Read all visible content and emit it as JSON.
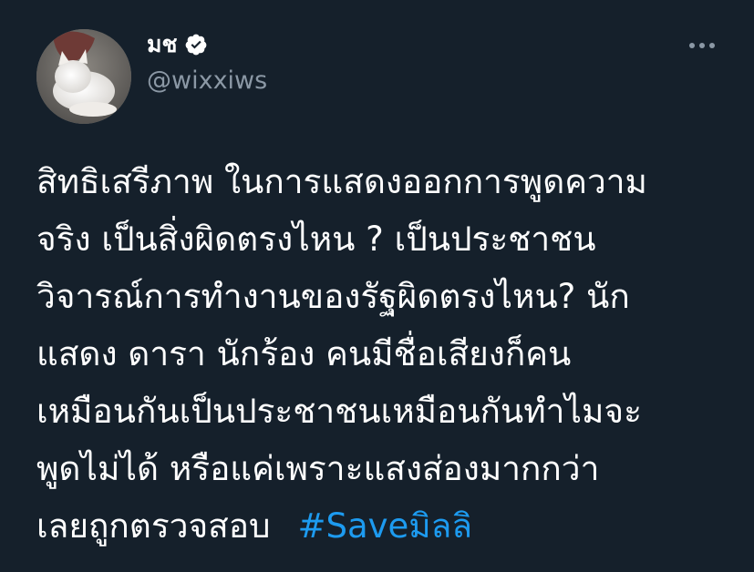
{
  "author": {
    "display_name": "มช",
    "handle": "@wixxiws",
    "verified": true,
    "avatar_icon": "cat-photo-avatar"
  },
  "more_icon": "more-horizontal-icon",
  "tweet": {
    "lines": [
      "สิทธิเสรีภาพ ในการแสดงออกการพูดความ",
      "จริง เป็นสิ่งผิดตรงไหน ?  เป็นประชาชน",
      "วิจารณ์การทำงานของรัฐผิดตรงไหน?  นัก",
      "แสดง ดารา นักร้อง คนมีชื่อเสียงก็คน",
      "เหมือนกันเป็นประชาชนเหมือนกันทำไมจะ",
      "พูดไม่ได้ หรือแค่เพราะแสงส่องมากกว่า",
      "เลยถูกตรวจสอบ"
    ],
    "hashtag": "#Saveมิลลิ"
  },
  "colors": {
    "background": "#15202b",
    "text": "#ffffff",
    "secondary": "#8b98a5",
    "link": "#1d9bf0"
  }
}
